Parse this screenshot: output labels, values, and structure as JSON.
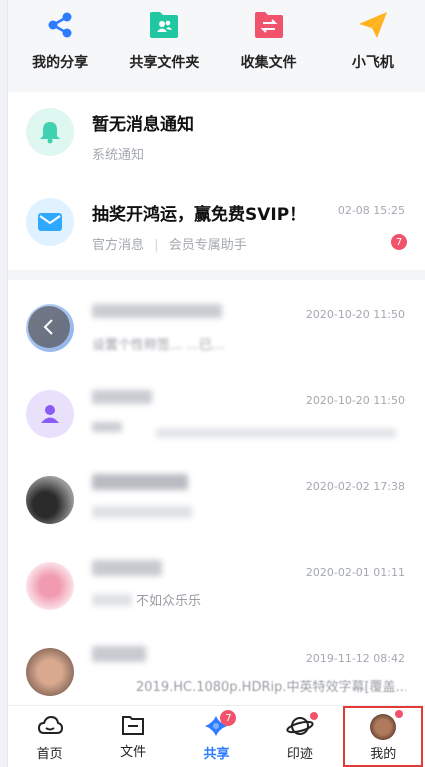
{
  "quick_actions": [
    {
      "label": "我的分享",
      "icon": "share-icon",
      "color": "#2f7bff"
    },
    {
      "label": "共享文件夹",
      "icon": "shared-folder-icon",
      "color": "#21c7a0"
    },
    {
      "label": "收集文件",
      "icon": "collect-file-icon",
      "color": "#f0536b"
    },
    {
      "label": "小飞机",
      "icon": "paper-plane-icon",
      "color": "#ffb21c"
    }
  ],
  "notices": [
    {
      "title": "暂无消息通知",
      "sub": "系统通知",
      "icon": "bell-icon",
      "color": "#3fd1b0",
      "bg": "#dff7f1"
    },
    {
      "title": "抽奖开鸿运，赢免费SVIP！",
      "sub": "官方消息",
      "sub2": "会员专属助手",
      "time": "02-08 15:25",
      "badge": "7",
      "icon": "mail-icon",
      "color": "#2fa9ff",
      "bg": "#e0f2ff"
    }
  ],
  "chats": [
    {
      "time": "2020-10-20 11:50",
      "preview": "设置个性称签...                                  ...已..."
    },
    {
      "time": "2020-10-20 11:50",
      "preview": ""
    },
    {
      "time": "2020-02-02 17:38",
      "preview": ""
    },
    {
      "time": "2020-02-01 01:11",
      "preview": "不如众乐乐"
    },
    {
      "time": "2019-11-12 08:42",
      "preview": "2019.HC.1080p.HDRip.中英特效字幕[覆盖..."
    }
  ],
  "tabs": [
    {
      "label": "首页",
      "icon": "home-cloud-icon"
    },
    {
      "label": "文件",
      "icon": "folder-icon"
    },
    {
      "label": "共享",
      "icon": "share-star-icon",
      "badge": "7",
      "active": true
    },
    {
      "label": "印迹",
      "icon": "planet-icon",
      "dot": true
    },
    {
      "label": "我的",
      "icon": "avatar-icon",
      "dot": true,
      "highlight": true
    }
  ]
}
